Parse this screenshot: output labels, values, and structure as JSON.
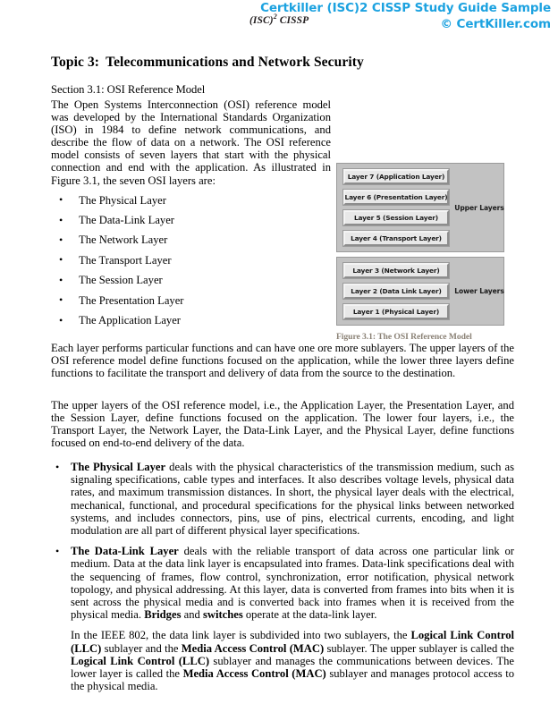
{
  "header": {
    "brand_left": "(ISC)",
    "brand_left_sup": "2",
    "brand_left_tail": " CISSP",
    "line1": "Certkiller (ISC)2 CISSP Study Guide Sample",
    "line2": "© CertKiller.com",
    "accent_color": "#1ca2e0"
  },
  "document": {
    "topic_number": "Topic 3:",
    "topic_title": "Telecommunications and Network Security",
    "section_heading": "Section 3.1: OSI Reference Model",
    "intro_paragraph": "The Open Systems Interconnection (OSI) reference model was developed by the International Standards Organization (ISO) in 1984 to define network communications, and describe the flow of data on a network. The OSI reference model consists of seven layers that start with the physical connection and end with the application. As illustrated in Figure 3.1, the seven OSI layers are:",
    "layer_list": [
      "The Physical Layer",
      "The Data-Link Layer",
      "The Network Layer",
      "The Transport Layer",
      "The Session Layer",
      "The Presentation Layer",
      "The Application Layer"
    ],
    "bullet_glyph": "•",
    "paragraph_each_layer": "Each layer performs particular functions and can have one ore more sublayers. The upper layers of the OSI reference model define functions focused on the application, while the lower three layers define functions to facilitate the transport and delivery of data from the source to the destination.",
    "paragraph_upper_lower": "The upper layers of the OSI reference model, i.e., the Application Layer, the Presentation Layer, and the Session Layer, define functions focused on the application. The lower four layers, i.e., the Transport Layer, the Network Layer, the Data-Link Layer, and the Physical Layer, define functions focused on end-to-end delivery of the data.",
    "physical_layer_bullet": {
      "lead": "The Physical Layer",
      "rest": " deals with the physical characteristics of the transmission medium, such as signaling specifications, cable types and interfaces. It also describes voltage levels, physical data rates, and maximum transmission distances. In short, the physical layer deals with the electrical, mechanical, functional, and procedural specifications for the physical links between networked systems, and includes connectors, pins, use of pins, electrical currents, encoding, and light modulation are all part of different physical layer specifications."
    },
    "datalink_layer_bullet": {
      "lead": "The Data-Link Layer",
      "part1": " deals with the reliable transport of data across one particular link or medium. Data at the data link layer is encapsulated into frames. Data-link specifications deal with the sequencing of frames, flow control, synchronization, error notification, physical network topology, and physical addressing. At this layer, data is converted from frames into bits when it is sent across the physical media and is converted back into frames when it is received from the physical media. ",
      "bold2": "Bridges",
      "part2": " and ",
      "bold3": "switches",
      "part3": " operate at the data-link layer."
    },
    "ieee_paragraph": {
      "p1": "In the IEEE 802, the data link layer is subdivided into two sublayers, the ",
      "b1": "Logical Link Control (LLC)",
      "p2": " sublayer and the ",
      "b2": "Media Access Control (MAC)",
      "p3": " sublayer. The upper sublayer is called the ",
      "b3": "Logical Link Control (LLC)",
      "p4": " sublayer and manages the communications between devices. The lower layer is called the ",
      "b4": "Media Access Control (MAC)",
      "p5": " sublayer and manages protocol access to the physical media."
    }
  },
  "figure": {
    "caption": "Figure 3.1: The OSI Reference Model",
    "caption_color": "#8a8175",
    "panel_bg": "#c2c2c2",
    "box_bg": "#e8e8e8",
    "upper_group_label": "Upper Layers",
    "lower_group_label": "Lower Layers",
    "upper_layers": [
      "Layer 7 (Application Layer)",
      "Layer 6 (Presentation Layer)",
      "Layer 5 (Session Layer)",
      "Layer 4 (Transport Layer)"
    ],
    "lower_layers": [
      "Layer 3 (Network Layer)",
      "Layer 2 (Data Link Layer)",
      "Layer 1 (Physical Layer)"
    ]
  }
}
